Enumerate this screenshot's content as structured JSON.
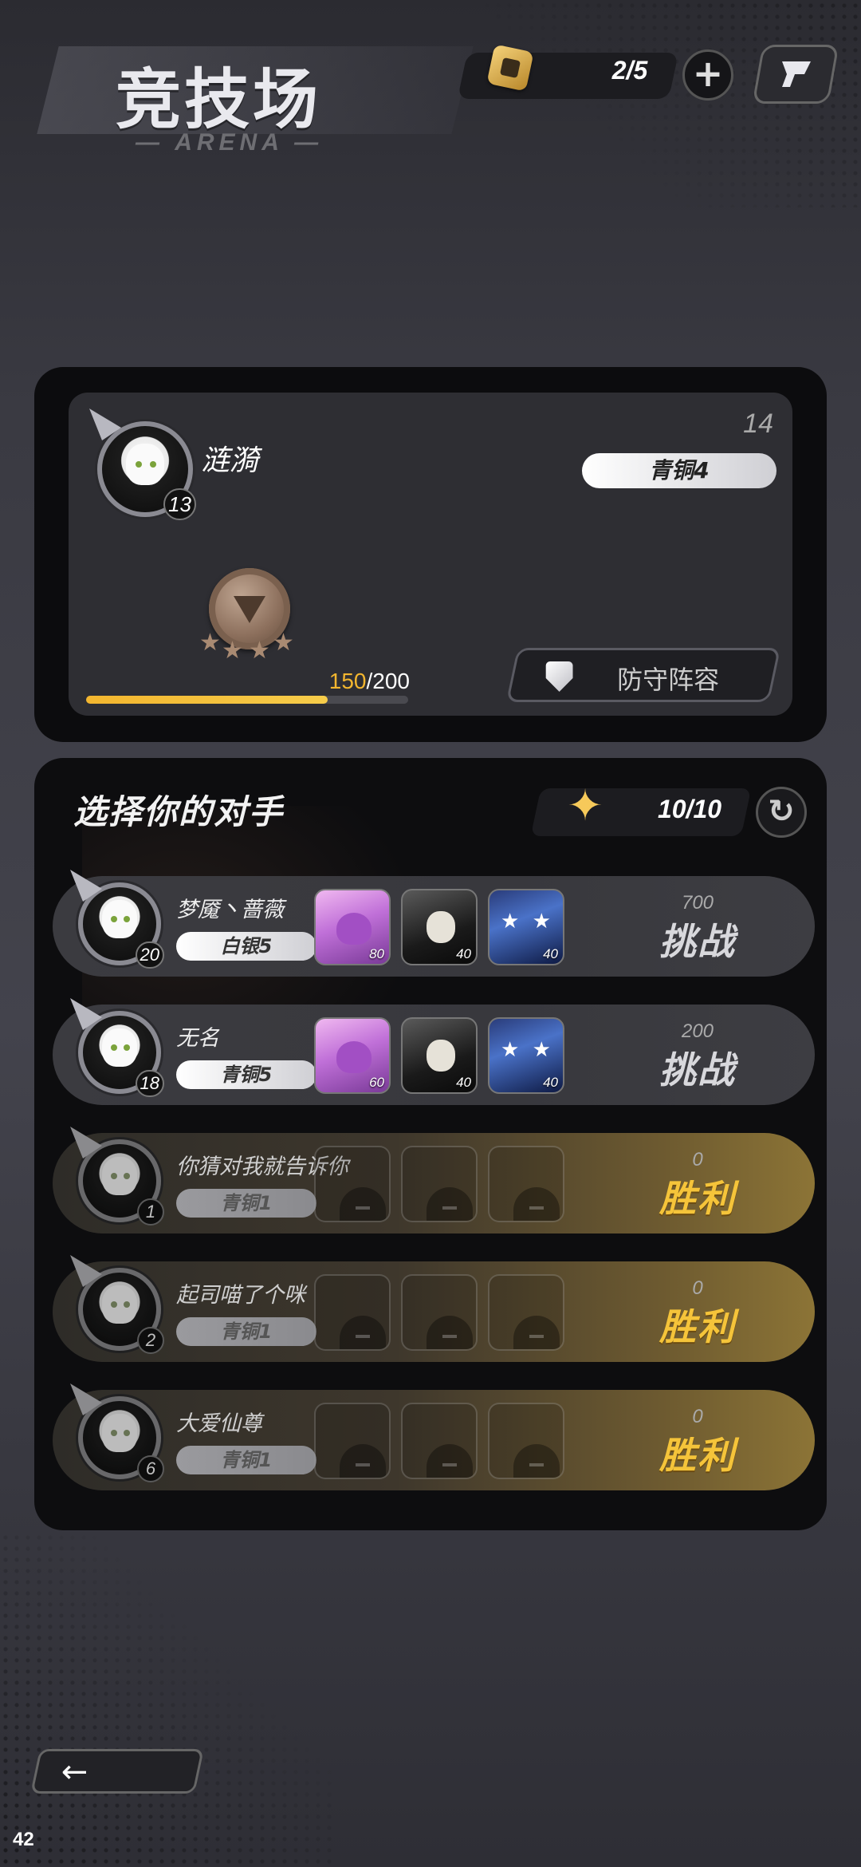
{
  "header": {
    "title": "竞技场",
    "subtitle": "— ARENA —",
    "ticket_count": "2/5",
    "plus_label": "+"
  },
  "player": {
    "name": "涟漪",
    "level": "13",
    "rank_number": "14",
    "rank_title": "青铜4",
    "progress_current": "150",
    "progress_max": "/200",
    "progress_fraction": 0.75,
    "defense_label": "防守阵容"
  },
  "opponents_panel": {
    "title": "选择你的对手",
    "challenge_count": "10/10"
  },
  "opponents": [
    {
      "name": "梦魇丶蔷薇",
      "level": "20",
      "rank": "白银5",
      "score": "700",
      "action": "挑战",
      "won": false,
      "heroes": [
        {
          "type": "pink",
          "level": "80"
        },
        {
          "type": "dark",
          "level": "40"
        },
        {
          "type": "blue",
          "level": "40"
        }
      ]
    },
    {
      "name": "无名",
      "level": "18",
      "rank": "青铜5",
      "score": "200",
      "action": "挑战",
      "won": false,
      "heroes": [
        {
          "type": "pink",
          "level": "60"
        },
        {
          "type": "dark",
          "level": "40"
        },
        {
          "type": "blue",
          "level": "40"
        }
      ]
    },
    {
      "name": "你猜对我就告诉你",
      "level": "1",
      "rank": "青铜1",
      "score": "0",
      "action": "胜利",
      "won": true,
      "heroes": []
    },
    {
      "name": "起司喵了个咪",
      "level": "2",
      "rank": "青铜1",
      "score": "0",
      "action": "胜利",
      "won": true,
      "heroes": []
    },
    {
      "name": "大爱仙尊",
      "level": "6",
      "rank": "青铜1",
      "score": "0",
      "action": "胜利",
      "won": true,
      "heroes": []
    }
  ],
  "footer": {
    "back_label": "←",
    "corner_number": "42"
  },
  "colors": {
    "accent_gold": "#f3b62f",
    "victory_gold": "#f5c43a"
  },
  "icons": {
    "ticket": "arena-ticket-icon",
    "challenge": "challenge-star-icon",
    "refresh": "refresh-icon",
    "defense": "shield-icon",
    "menu": "menu-icon"
  }
}
